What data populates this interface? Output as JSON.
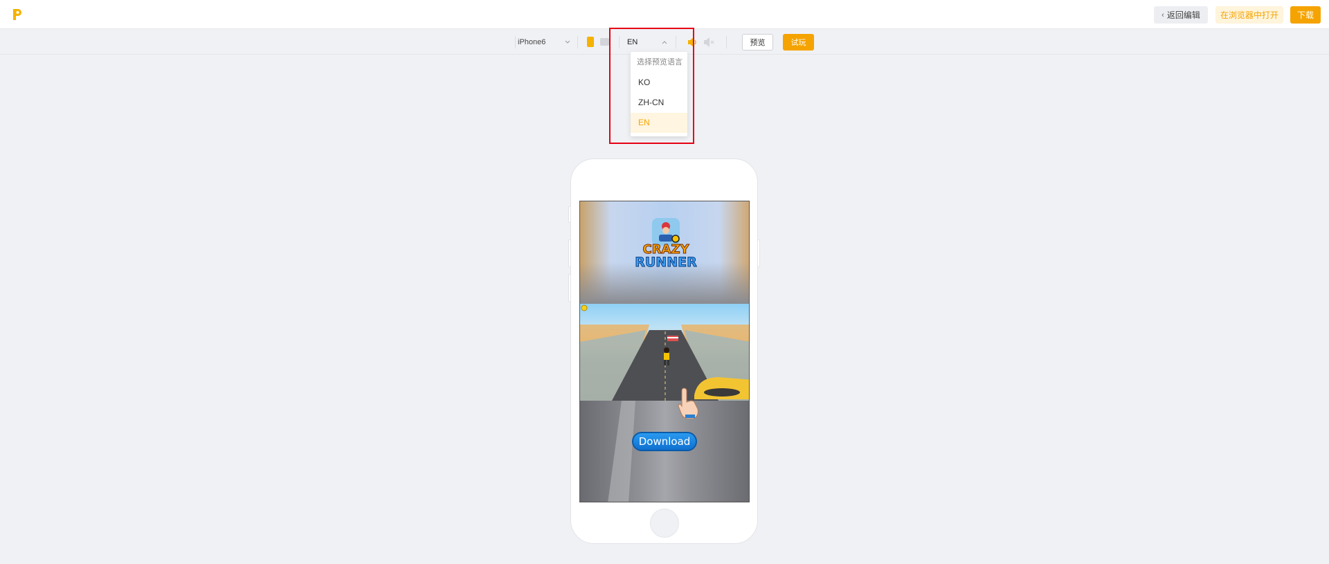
{
  "topbar": {
    "logo_icon": "brand-p-logo",
    "back_label": "返回编辑",
    "open_browser_label": "在浏览器中打开",
    "download_label": "下载"
  },
  "toolbar": {
    "device": "iPhone6",
    "language": "EN",
    "preview_label": "预览",
    "play_label": "试玩"
  },
  "language_dropdown": {
    "header": "选择预览语言",
    "options": [
      "KO",
      "ZH-CN",
      "EN"
    ],
    "selected": "EN"
  },
  "ad": {
    "game_title_line1": "CRAZY",
    "game_title_line2": "RUNNER",
    "cta_label": "Download"
  },
  "colors": {
    "accent": "#f5a300",
    "highlight_border": "#e60012",
    "background": "#f0f1f5"
  }
}
